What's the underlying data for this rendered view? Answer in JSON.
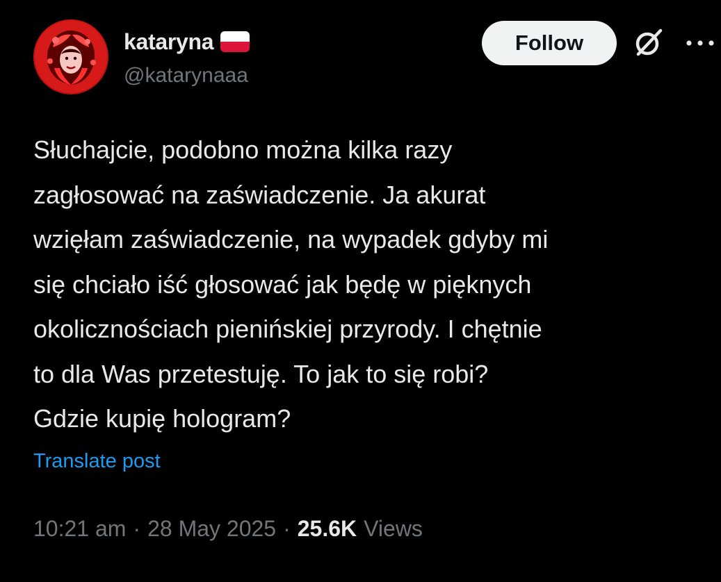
{
  "author": {
    "display_name": "kataryna",
    "handle": "@katarynaaa",
    "flag_icon": "poland-flag-icon",
    "avatar_icon": "avatar-red-illustration"
  },
  "actions": {
    "follow_label": "Follow",
    "grok_icon": "grok-icon",
    "more_icon": "more-options-icon"
  },
  "tweet": {
    "text": "Słuchajcie, podobno można kilka razy\nzagłosować na zaświadczenie. Ja akurat\nwzięłam zaświadczenie, na wypadek gdyby mi\nsię chciało iść głosować jak będę w pięknych\nokolicznościach pienińskiej przyrody. I chętnie\nto dla Was przetestuję. To jak to się robi?\nGdzie kupię hologram?",
    "translate_label": "Translate post"
  },
  "meta": {
    "time": "10:21 am",
    "separator": "·",
    "date": "28 May 2025",
    "views_count": "25.6K",
    "views_label": "Views"
  },
  "colors": {
    "background": "#000000",
    "text_primary": "#e7e9ea",
    "text_secondary": "#71767b",
    "link": "#1d9bf0",
    "follow_bg": "#eff3f4"
  }
}
